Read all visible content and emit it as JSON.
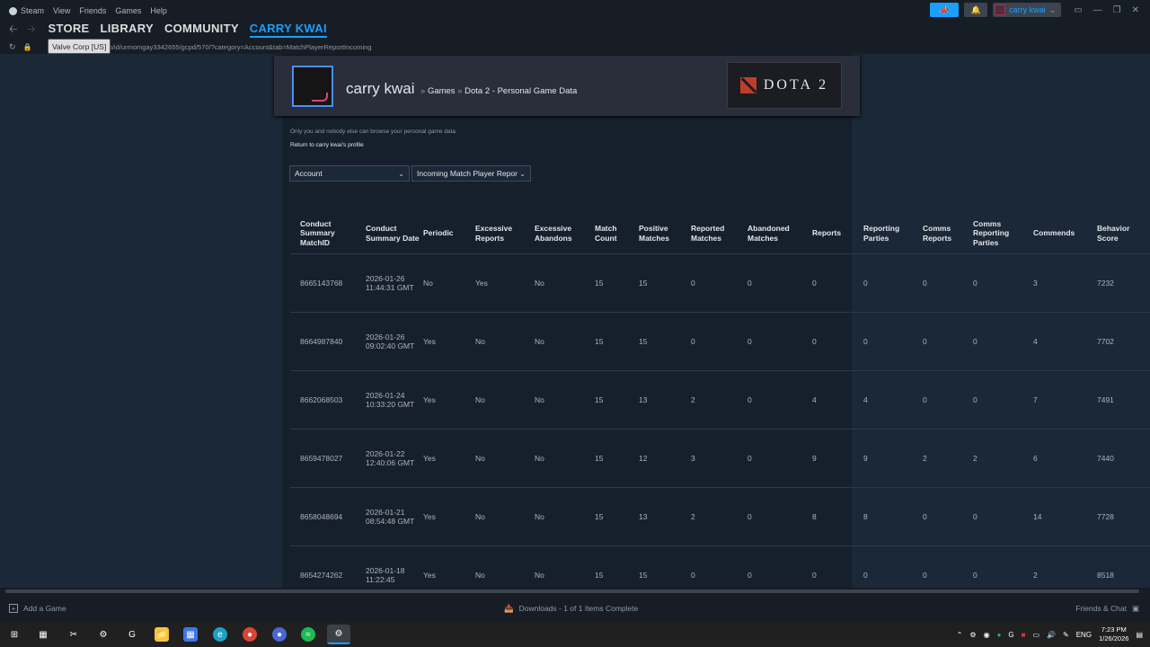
{
  "menubar": {
    "items": [
      "Steam",
      "View",
      "Friends",
      "Games",
      "Help"
    ],
    "username": "carry kwai"
  },
  "nav": {
    "links": [
      "STORE",
      "LIBRARY",
      "COMMUNITY",
      "CARRY KWAI"
    ]
  },
  "urlbar": {
    "url": "y.com/id/urmomgay3342655/gcpd/570/?category=Account&tab=MatchPlayerReportIncoming",
    "tooltip": "Valve Corp [US]"
  },
  "profile": {
    "name": "carry kwai",
    "crumb_sep": "»",
    "crumb_games": "Games",
    "crumb_game": "Dota 2 - Personal Game Data",
    "logo_text": "DOTA 2"
  },
  "info": {
    "privacy": "Only you and nobody else can browse your personal game data.",
    "return_link": "Return to carry kwai's profile"
  },
  "selects": {
    "category": "Account",
    "tab": "Incoming Match Player Repor"
  },
  "table": {
    "headers": [
      "Conduct Summary MatchID",
      "Conduct Summary Date",
      "Periodic",
      "Excessive Reports",
      "Excessive Abandons",
      "Match Count",
      "Positive Matches",
      "Reported Matches",
      "Abandoned Matches",
      "Reports",
      "Reporting Parties",
      "Comms Reports",
      "Comms Reporting Parties",
      "Commends",
      "Behavior Score"
    ],
    "rows": [
      [
        "8665143768",
        "2026-01-26 11:44:31 GMT",
        "No",
        "Yes",
        "No",
        "15",
        "15",
        "0",
        "0",
        "0",
        "0",
        "0",
        "0",
        "3",
        "7232"
      ],
      [
        "8664987840",
        "2026-01-26 09:02:40 GMT",
        "Yes",
        "No",
        "No",
        "15",
        "15",
        "0",
        "0",
        "0",
        "0",
        "0",
        "0",
        "4",
        "7702"
      ],
      [
        "8662068503",
        "2026-01-24 10:33:20 GMT",
        "Yes",
        "No",
        "No",
        "15",
        "13",
        "2",
        "0",
        "4",
        "4",
        "0",
        "0",
        "7",
        "7491"
      ],
      [
        "8659478027",
        "2026-01-22 12:40:06 GMT",
        "Yes",
        "No",
        "No",
        "15",
        "12",
        "3",
        "0",
        "9",
        "9",
        "2",
        "2",
        "6",
        "7440"
      ],
      [
        "8658048694",
        "2026-01-21 08:54:48 GMT",
        "Yes",
        "No",
        "No",
        "15",
        "13",
        "2",
        "0",
        "8",
        "8",
        "0",
        "0",
        "14",
        "7728"
      ],
      [
        "8654274262",
        "2026-01-18 11:22:45",
        "Yes",
        "No",
        "No",
        "15",
        "15",
        "0",
        "0",
        "0",
        "0",
        "0",
        "0",
        "2",
        "8518"
      ]
    ]
  },
  "bottombar": {
    "add_game": "Add a Game",
    "downloads": "Downloads - 1 of 1 Items Complete",
    "friends": "Friends & Chat"
  },
  "taskbar": {
    "lang": "ENG",
    "time": "7:23 PM",
    "date": "1/26/2026"
  },
  "colors": {
    "accent": "#1a9fff",
    "bg": "#1b2838",
    "panel": "#16202d"
  }
}
